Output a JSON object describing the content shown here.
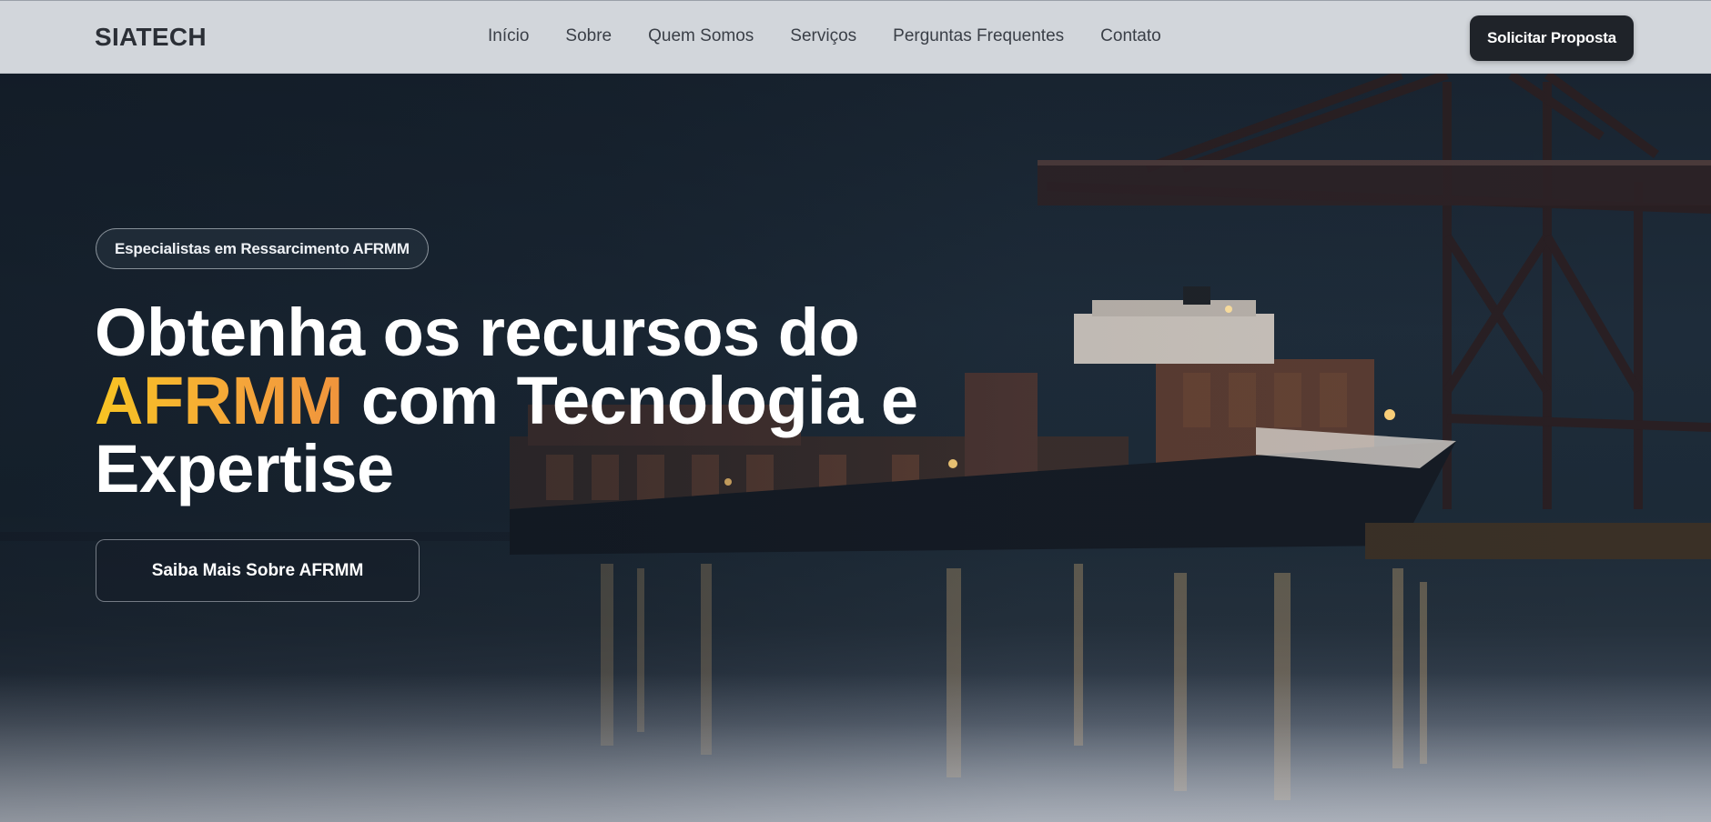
{
  "nav": {
    "logo": "SIATECH",
    "links": [
      "Início",
      "Sobre",
      "Quem Somos",
      "Serviços",
      "Perguntas Frequentes",
      "Contato"
    ],
    "cta_label": "Solicitar Proposta"
  },
  "hero": {
    "badge": "Especialistas em Ressarcimento AFRMM",
    "headline_line1": "Obtenha os recursos do",
    "headline_accent": "AFRMM",
    "headline_line2_rest": " com Tecnologia e",
    "headline_line3": "Expertise",
    "button_label": "Saiba Mais Sobre AFRMM",
    "background_image": "container-ship-at-port-night"
  },
  "colors": {
    "accent_start": "#f7c423",
    "accent_end": "#f0943c",
    "cta_bg": "#1f2329",
    "navbar_bg": "#d2d6db"
  }
}
